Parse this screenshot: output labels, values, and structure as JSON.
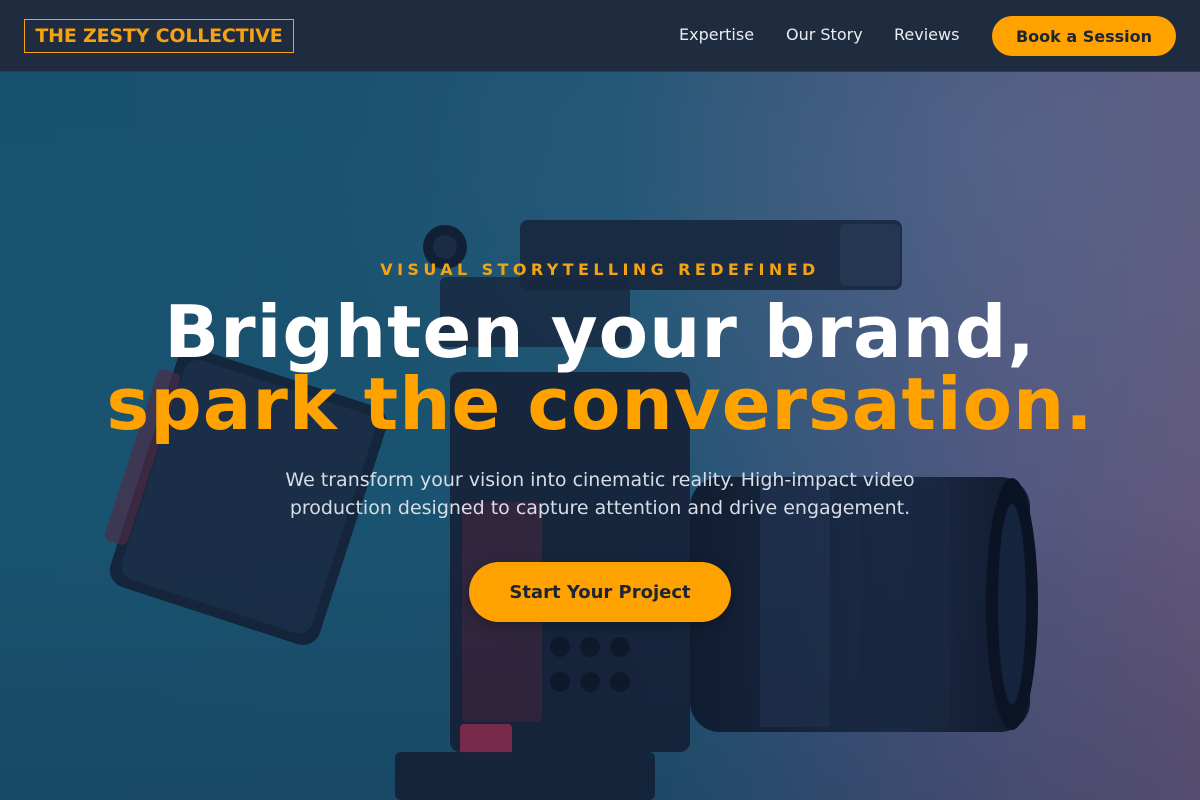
{
  "brand": {
    "name": "THE ZESTY COLLECTIVE"
  },
  "nav": {
    "links": [
      "Expertise",
      "Our Story",
      "Reviews"
    ],
    "cta_label": "Book a Session"
  },
  "hero": {
    "eyebrow": "VISUAL STORYTELLING REDEFINED",
    "headline_line1": "Brighten your brand,",
    "headline_line2": "spark the conversation.",
    "subtext": "We transform your vision into cinematic reality. High-impact video production designed to capture attention and drive engagement.",
    "cta_label": "Start Your Project",
    "background_image": "cinema-camera-photo"
  },
  "colors": {
    "accent": "#ffa200",
    "nav_bg": "#1f2b3e",
    "text_light": "#ffffff"
  }
}
